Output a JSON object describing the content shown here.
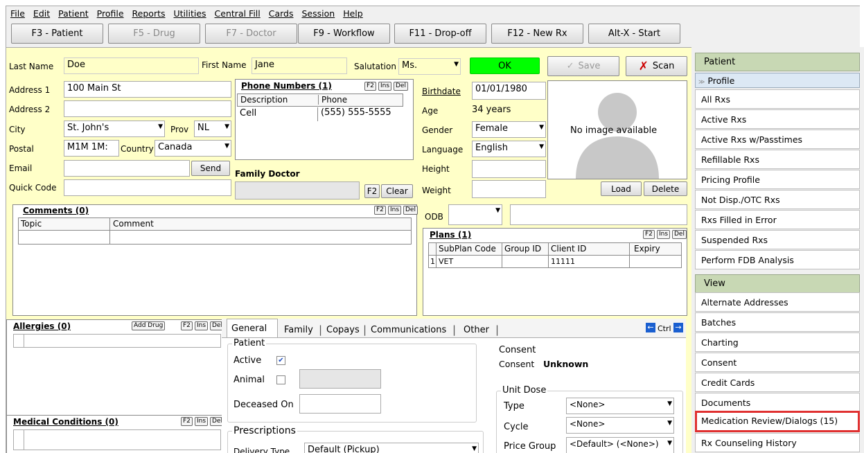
{
  "menu": [
    "File",
    "Edit",
    "Patient",
    "Profile",
    "Reports",
    "Utilities",
    "Central Fill",
    "Cards",
    "Session",
    "Help"
  ],
  "toolbar": {
    "patient": "F3 - Patient",
    "drug": "F5 - Drug",
    "doctor": "F7 - Doctor",
    "workflow": "F9 - Workflow",
    "dropoff": "F11 - Drop-off",
    "newrx": "F12 - New Rx",
    "start": "Alt-X - Start"
  },
  "patient": {
    "last_name_label": "Last Name",
    "last_name": "Doe",
    "first_name_label": "First Name",
    "first_name": "Jane",
    "salutation_label": "Salutation",
    "salutation": "Ms.",
    "ok": "OK",
    "save": "Save",
    "scan": "Scan",
    "address1_label": "Address 1",
    "address1": "100 Main St",
    "address2_label": "Address 2",
    "address2": "",
    "city_label": "City",
    "city": "St. John's",
    "prov_label": "Prov",
    "prov": "NL",
    "postal_label": "Postal",
    "postal": "M1M 1M:",
    "country_label": "Country",
    "country": "Canada",
    "email_label": "Email",
    "send": "Send",
    "quick_code_label": "Quick Code",
    "family_doctor_label": "Family Doctor",
    "f2": "F2",
    "clear": "Clear",
    "birthdate_label": "Birthdate",
    "birthdate": "01/01/1980",
    "age_label": "Age",
    "age": "34 years",
    "gender_label": "Gender",
    "gender": "Female",
    "language_label": "Language",
    "language": "English",
    "height_label": "Height",
    "weight_label": "Weight",
    "odb_label": "ODB",
    "no_image": "No image available",
    "load": "Load",
    "delete": "Delete"
  },
  "phone": {
    "title": "Phone Numbers (1)",
    "col_desc": "Description",
    "col_phone": "Phone",
    "rows": [
      {
        "desc": "Cell",
        "phone": "(555) 555-5555"
      }
    ]
  },
  "comments": {
    "title": "Comments (0)",
    "col_topic": "Topic",
    "col_comment": "Comment"
  },
  "plans": {
    "title": "Plans (1)",
    "cols": [
      "SubPlan Code",
      "Group ID",
      "Client ID",
      "Expiry"
    ],
    "row": {
      "num": "1",
      "subplan": "VET",
      "group": "",
      "client": "11111",
      "expiry": ""
    }
  },
  "mini_btns": {
    "f2": "F2",
    "ins": "Ins",
    "del": "Del",
    "add_drug": "Add Drug"
  },
  "allergies": {
    "title": "Allergies (0)"
  },
  "medical": {
    "title": "Medical Conditions (0)"
  },
  "tabs": [
    "General",
    "Family",
    "Copays",
    "Communications",
    "Other"
  ],
  "ctrl": "Ctrl",
  "general": {
    "patient_legend": "Patient",
    "active": "Active",
    "animal": "Animal",
    "deceased": "Deceased On",
    "consent_legend": "Consent",
    "consent_label": "Consent",
    "consent_value": "Unknown",
    "unit_dose_legend": "Unit Dose",
    "type_label": "Type",
    "type_value": "<None>",
    "cycle_label": "Cycle",
    "cycle_value": "<None>",
    "price_group_label": "Price Group",
    "price_group_value": "<Default> (<None>)",
    "prescriptions_legend": "Prescriptions",
    "delivery_label": "Delivery Type",
    "delivery_value": "Default (Pickup)"
  },
  "sidebar": {
    "patient_head": "Patient",
    "profile_head": "Profile",
    "profile_items": [
      "All Rxs",
      "Active Rxs",
      "Active Rxs w/Passtimes",
      "Refillable Rxs",
      "Pricing Profile",
      "Not Disp./OTC Rxs",
      "Rxs Filled in Error",
      "Suspended Rxs",
      "Perform FDB Analysis"
    ],
    "view_head": "View",
    "view_items": [
      "Alternate Addresses",
      "Batches",
      "Charting",
      "Consent",
      "Credit Cards",
      "Documents",
      "Medication Review/Dialogs (15)",
      "Rx Counseling History"
    ]
  }
}
